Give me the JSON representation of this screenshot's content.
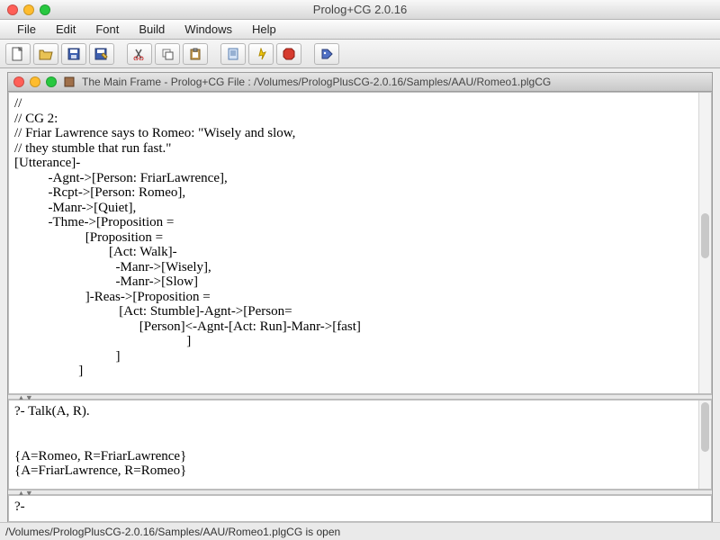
{
  "window": {
    "title": "Prolog+CG 2.0.16"
  },
  "menu": {
    "items": [
      "File",
      "Edit",
      "Font",
      "Build",
      "Windows",
      "Help"
    ]
  },
  "inner_window": {
    "title": "The Main Frame - Prolog+CG File : /Volumes/PrologPlusCG-2.0.16/Samples/AAU/Romeo1.plgCG"
  },
  "code_pane": {
    "text": "//\n// CG 2:\n// Friar Lawrence says to Romeo: \"Wisely and slow,\n// they stumble that run fast.\"\n[Utterance]-\n          -Agnt->[Person: FriarLawrence],\n          -Rcpt->[Person: Romeo],\n          -Manr->[Quiet],\n          -Thme->[Proposition =\n                     [Proposition =\n                            [Act: Walk]-\n                              -Manr->[Wisely],\n                              -Manr->[Slow]\n                     ]-Reas->[Proposition =\n                               [Act: Stumble]-Agnt->[Person=\n                                     [Person]<-Agnt-[Act: Run]-Manr->[fast]\n                                                   ]\n                              ]\n                   ]"
  },
  "console_pane": {
    "text": "?- Talk(A, R).\n\n\n{A=Romeo, R=FriarLawrence}\n{A=FriarLawrence, R=Romeo}"
  },
  "input_pane": {
    "text": "?-"
  },
  "statusbar": {
    "text": "/Volumes/PrologPlusCG-2.0.16/Samples/AAU/Romeo1.plgCG is open"
  }
}
